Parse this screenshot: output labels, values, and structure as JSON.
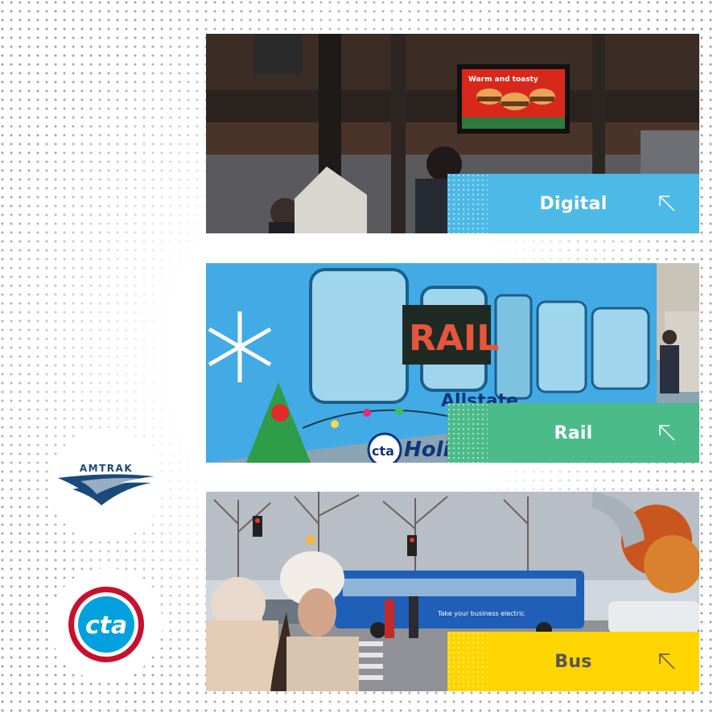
{
  "cards": [
    {
      "label": "Digital",
      "tab_color": "#4DB9E6",
      "label_color": "#ffffff"
    },
    {
      "label": "Rail",
      "tab_color": "#4CBB8A",
      "label_color": "#ffffff"
    },
    {
      "label": "Bus",
      "tab_color": "#FFD500",
      "label_color": "#555555"
    }
  ],
  "scene_text": {
    "digital_screen_headline": "Warm and toasty",
    "rail_sign": "RAIL",
    "rail_brand": "Allstate",
    "rail_logo": "cta",
    "rail_tag": "Holiday",
    "bus_ad": "Take your business electric"
  },
  "logos": {
    "amtrak": "AMTRAK",
    "cta": "cta"
  },
  "icons": {
    "back": "arrow-left-icon",
    "card_link": "arrow-up-left-icon"
  },
  "colors": {
    "dots": "#9a9a9a",
    "cta_red": "#C8102E",
    "cta_blue": "#00A1DE",
    "amtrak_blue": "#1A4A7A"
  }
}
